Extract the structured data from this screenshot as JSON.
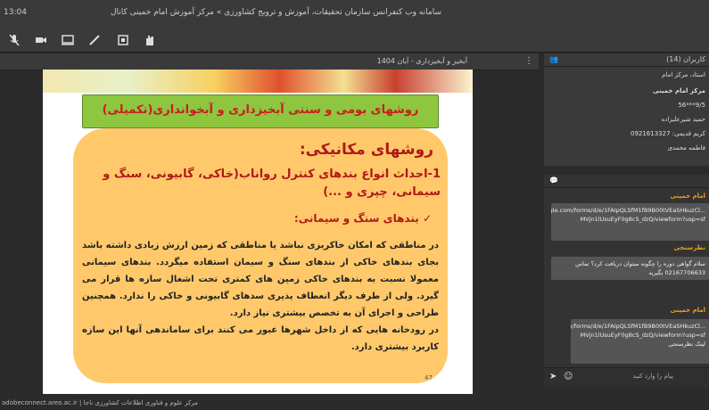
{
  "topbar": {
    "time": "13:04",
    "title": "سامانه وب کنفرانس سازمان تحقیقات، آموزش و ترویج کشاورزی » مرکز آموزش امام خمینی   کانال"
  },
  "slidebar": {
    "label": "آبخیز و آبخیزداری - آبان 1404"
  },
  "slide": {
    "banner": "روشهای بومی و سنتی آبخیزداری و آبخوانداری(تکمیلی)",
    "heading": "روشهای مکانیکی:",
    "subheading": "1-احداث انواع بندهای کنترل رواناب(خاکی، گابیونی، سنگ و سیمانی، چپری و ...)",
    "bullet": "بندهای سنگ و سیمانی:",
    "para1": "در مناطقی که امکان خاکریزی نباشد یا مناطقی که زمین ارزش زیادی داشته باشد بجای بندهای خاکی از بندهای سنگ و سیمان استفاده میگردد. بندهای سیمانی معمولا نسبت به بندهای خاکی زمین های کمتری تحت اشغال سازه ها قرار می گیرد. ولی از طرف دیگر انعطاف پذیری سدهای گابیونی و خاکی را ندارد. همچنین طراحی و اجرای آن به تخصص بیشتری نیاز دارد.",
    "para2": "در رودخانه هایی که از داخل شهرها عبور می کنند برای ساماندهی آنها این سازه کاربرد بیشتری دارد.",
    "page": "47"
  },
  "participants": {
    "header": "کاربران (14)",
    "items": [
      "استاد، مرکز امام",
      "مرکز امام خمینی",
      "9/5***56",
      "حمید شیرعلیزاده",
      "کریم قدیمی: 0921613327",
      "فاطمه محمدی"
    ]
  },
  "chat": {
    "msg1_name": "امام خمینی",
    "msg1_text": "https://docs.google.com/forms/d/e/1FAIpQLSfM1fB9B00tVEaSHkuzCl... MVjn1lUsuEyF0g8cS_dzQ/viewform?usp=sf",
    "msg2_name": "نظرسنجی",
    "msg2_text": "سلام گواهی دوره را چگونه میتوان دریافت کرد؟ تماس 02167706633 بگیرید",
    "msg3_name": "امام خمینی",
    "msg3_text": "https://docs.google.com/forms/d/e/1FAIpQLSfM1fB9B00tVEaSHkuzCl... MVjn1lUsuEyF0g8cS_dzQ/viewform?usp=sf لینک نظرسنجی",
    "placeholder": "پیام را وارد کنید"
  },
  "footer": {
    "text": "adobeconnect.areo.ac.ir | مرکز علوم و فناوری اطلاعات کشاورزی ناجا"
  }
}
